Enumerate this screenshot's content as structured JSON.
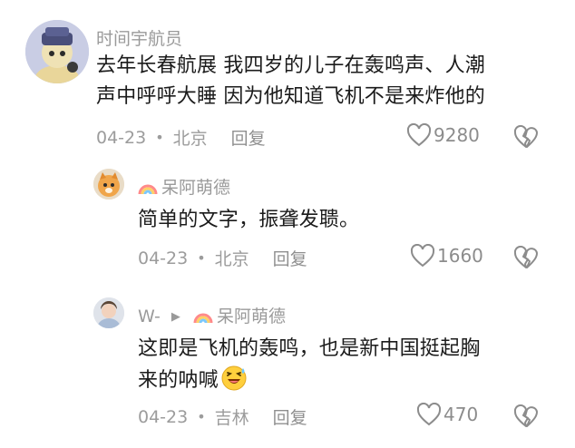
{
  "comments": [
    {
      "username": "时间宇航员",
      "text_line1": "去年长春航展 我四岁的儿子在轰鸣声、人潮",
      "text_line2": "声中呼呼大睡 因为他知道飞机不是来炸他的",
      "date": "04-23",
      "location": "北京",
      "reply_label": "回复",
      "likes": "9280"
    },
    {
      "username": "呆阿萌德",
      "text_line1": "简单的文字，振聋发聩。",
      "date": "04-23",
      "location": "北京",
      "reply_label": "回复",
      "likes": "1660"
    },
    {
      "username": "W-",
      "reply_to": "呆阿萌德",
      "text_line1": "这即是飞机的轰鸣，也是新中国挺起胸",
      "text_line2": "来的呐喊",
      "date": "04-23",
      "location": "吉林",
      "reply_label": "回复",
      "likes": "470"
    }
  ],
  "icons": {
    "like": "heart-outline-icon",
    "dislike": "broken-heart-icon",
    "badge": "rainbow-icon",
    "reply_arrow": "triangle-right-icon",
    "emoji": "laughing-sweat-emoji"
  },
  "colors": {
    "text": "#1b1b1b",
    "muted": "#9a9a9a"
  }
}
